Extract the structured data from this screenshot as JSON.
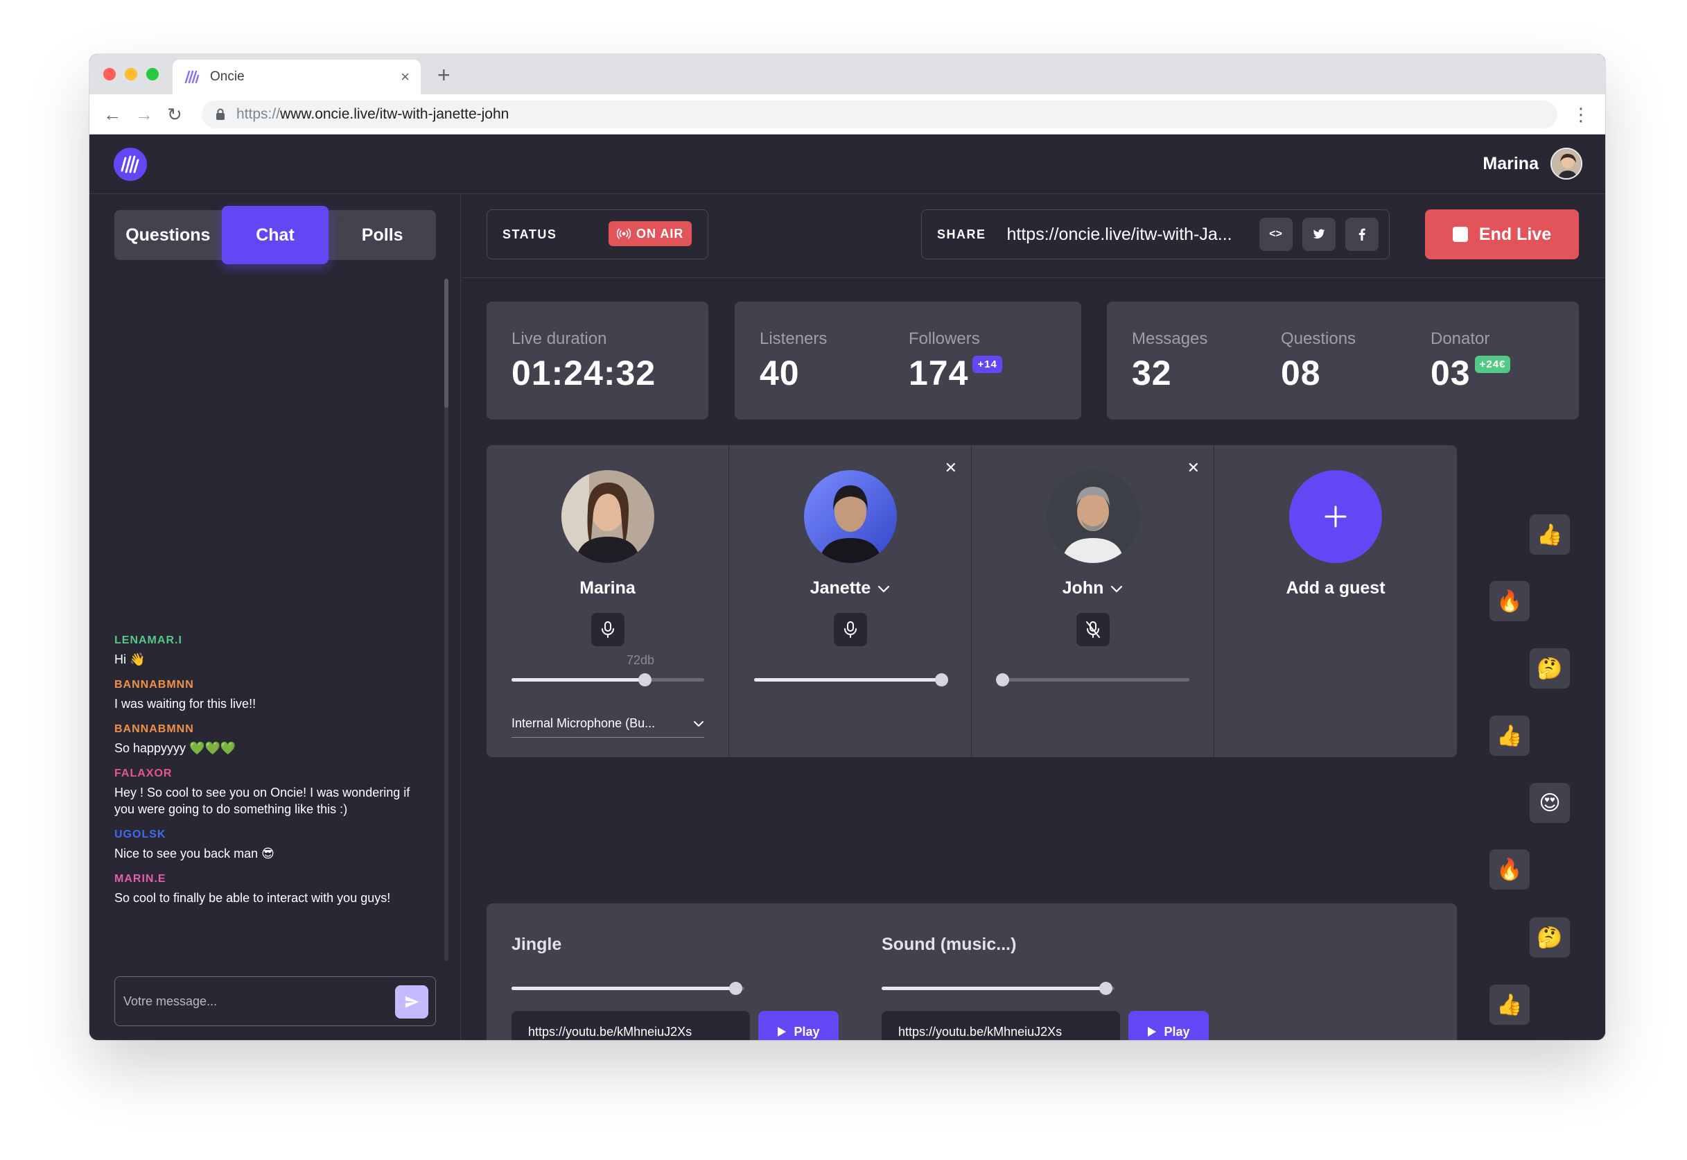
{
  "browser": {
    "tab_title": "Oncie",
    "url_scheme": "https://",
    "url_host": "www.oncie.live/itw-with-janette-john",
    "new_tab_label": "+",
    "close_tab_label": "×",
    "back_label": "←",
    "forward_label": "→",
    "reload_label": "↻",
    "menu_label": "⋮"
  },
  "header": {
    "user_name": "Marina"
  },
  "sidebar": {
    "tabs": [
      {
        "label": "Questions",
        "active": false
      },
      {
        "label": "Chat",
        "active": true
      },
      {
        "label": "Polls",
        "active": false
      }
    ],
    "messages": [
      {
        "user": "LENAMAR.I",
        "color": "#53c985",
        "text": "Hi 👋"
      },
      {
        "user": "BANNABMNN",
        "color": "#f0914a",
        "text": "I was waiting for this live!!"
      },
      {
        "user": "BANNABMNN",
        "color": "#f0914a",
        "text": "So happyyyy 💚💚💚"
      },
      {
        "user": "FALAXOR",
        "color": "#e3598c",
        "text": "Hey ! So cool to see you on Oncie! I was wondering if you were going to do something like this :)"
      },
      {
        "user": "UGOLSK",
        "color": "#3d6cf0",
        "text": "Nice to see you back man 😎"
      },
      {
        "user": "MARIN.E",
        "color": "#e35fae",
        "text": "So cool to finally be able to interact with you guys!"
      }
    ],
    "input_placeholder": "Votre message..."
  },
  "status": {
    "label": "STATUS",
    "badge": "ON AIR"
  },
  "share": {
    "label": "SHARE",
    "url": "https://oncie.live/itw-with-Ja...",
    "embed_label": "<>",
    "twitter_label": "t",
    "facebook_label": "f"
  },
  "end_live_label": "End Live",
  "stats": {
    "duration_label": "Live duration",
    "duration_value": "01:24:32",
    "listeners_label": "Listeners",
    "listeners_value": "40",
    "followers_label": "Followers",
    "followers_value": "174",
    "followers_badge": "+14",
    "messages_label": "Messages",
    "messages_value": "32",
    "questions_label": "Questions",
    "questions_value": "08",
    "donator_label": "Donator",
    "donator_value": "03",
    "donator_badge": "+24€"
  },
  "guests": [
    {
      "name": "Marina",
      "muted": false,
      "volume": 0.69,
      "db_label": "72db",
      "device": "Internal Microphone (Bu..."
    },
    {
      "name": "Janette",
      "muted": false,
      "volume": 0.97,
      "removable": true
    },
    {
      "name": "John",
      "muted": true,
      "volume": 0.03,
      "removable": true
    }
  ],
  "add_guest_label": "Add a guest",
  "sound": {
    "jingle_title": "Jingle",
    "jingle_volume": 0.96,
    "jingle_url": "https://youtu.be/kMhneiuJ2Xs",
    "music_title": "Sound (music...)",
    "music_volume": 0.96,
    "music_url": "https://youtu.be/kMhneiuJ2Xs",
    "play_label": "Play"
  },
  "reactions": [
    "👍",
    "🔥",
    "🤔",
    "👍",
    "😍",
    "🔥",
    "🤔",
    "👍"
  ],
  "colors": {
    "accent": "#6346f4",
    "danger": "#e3545a",
    "success": "#53c985",
    "background": "#282733",
    "card": "#42414e"
  }
}
